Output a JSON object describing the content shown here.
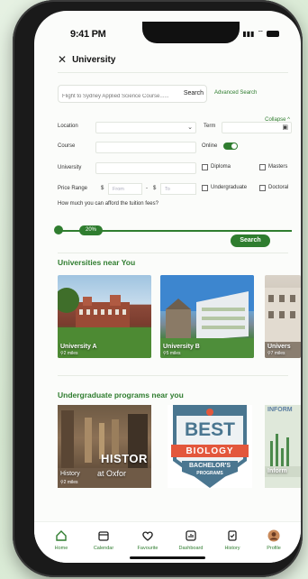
{
  "status": {
    "time": "9:41 PM"
  },
  "header": {
    "title": "University"
  },
  "search": {
    "placeholder": "Flight to Sydney Applied Science Course......",
    "button": "Search",
    "advanced": "Advanced Search",
    "collapse": "Collapse ^"
  },
  "filters": {
    "location": "Location",
    "term": "Term",
    "course": "Course",
    "online": "Online",
    "university": "University",
    "diploma": "Diploma",
    "masters": "Masters",
    "price_range": "Price Range",
    "currency1": "$",
    "from": "From",
    "dash": "-",
    "currency2": "$",
    "to": "To",
    "undergraduate": "Undergraduate",
    "doctoral": "Doctoral",
    "afford_question": "How much you can afford the tuition fees?",
    "slider_value": "20%",
    "search_button": "Search"
  },
  "universities": {
    "title": "Universities near You",
    "items": [
      {
        "name": "University A",
        "distance": "2 miles"
      },
      {
        "name": "University B",
        "distance": "5 miles"
      },
      {
        "name": "Univers",
        "distance": "7 miles"
      }
    ]
  },
  "programs": {
    "title": "Undergraduate programs near you",
    "items": [
      {
        "name": "History",
        "overlay": "HISTOR",
        "sub_overlay": "at Oxfor",
        "distance": "2 miles"
      },
      {
        "banner": "BEST",
        "subject": "BIOLOGY",
        "degree": "BACHELOR'S",
        "sub_degree": "PROGRAMS"
      },
      {
        "header": "INFORM",
        "footer": "Inform"
      }
    ]
  },
  "tabs": [
    {
      "label": "Home",
      "icon": "home-icon"
    },
    {
      "label": "Calendar",
      "icon": "calendar-icon"
    },
    {
      "label": "Favourite",
      "icon": "heart-icon"
    },
    {
      "label": "Dashboard",
      "icon": "dashboard-icon"
    },
    {
      "label": "History",
      "icon": "history-icon"
    },
    {
      "label": "Profile",
      "icon": "avatar"
    }
  ],
  "colors": {
    "accent": "#2f7d2f",
    "bg": "#fbfcfa"
  }
}
